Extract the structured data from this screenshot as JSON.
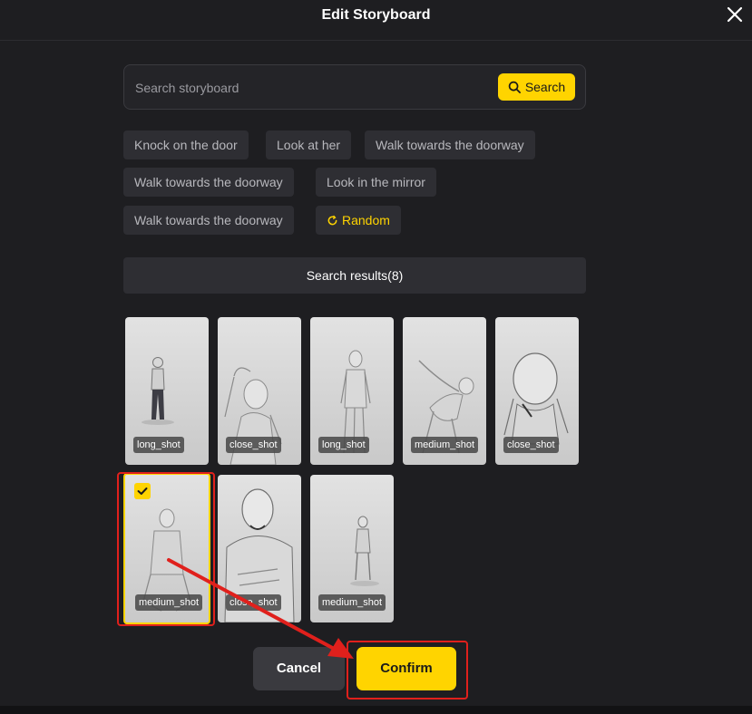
{
  "dialog": {
    "title": "Edit Storyboard"
  },
  "search": {
    "placeholder": "Search storyboard",
    "button_label": "Search"
  },
  "chips": {
    "items": [
      "Knock on the door",
      "Look at her",
      "Walk towards the doorway",
      "Walk towards the doorway",
      "Look in the mirror",
      "Walk towards the doorway"
    ],
    "random_label": "Random"
  },
  "results": {
    "header": "Search results(8)",
    "cards": [
      {
        "label": "long_shot",
        "selected": false
      },
      {
        "label": "close_shot",
        "selected": false
      },
      {
        "label": "long_shot",
        "selected": false
      },
      {
        "label": "medium_shot",
        "selected": false
      },
      {
        "label": "close_shot",
        "selected": false
      },
      {
        "label": "medium_shot",
        "selected": true
      },
      {
        "label": "close_shot",
        "selected": false
      },
      {
        "label": "medium_shot",
        "selected": false
      }
    ]
  },
  "actions": {
    "cancel_label": "Cancel",
    "confirm_label": "Confirm"
  },
  "colors": {
    "accent": "#ffd400",
    "background": "#1e1e21",
    "annotation": "#e0201c"
  },
  "icons": {
    "close": "close-icon",
    "search": "search-icon",
    "random": "refresh-icon",
    "check": "check-icon"
  }
}
